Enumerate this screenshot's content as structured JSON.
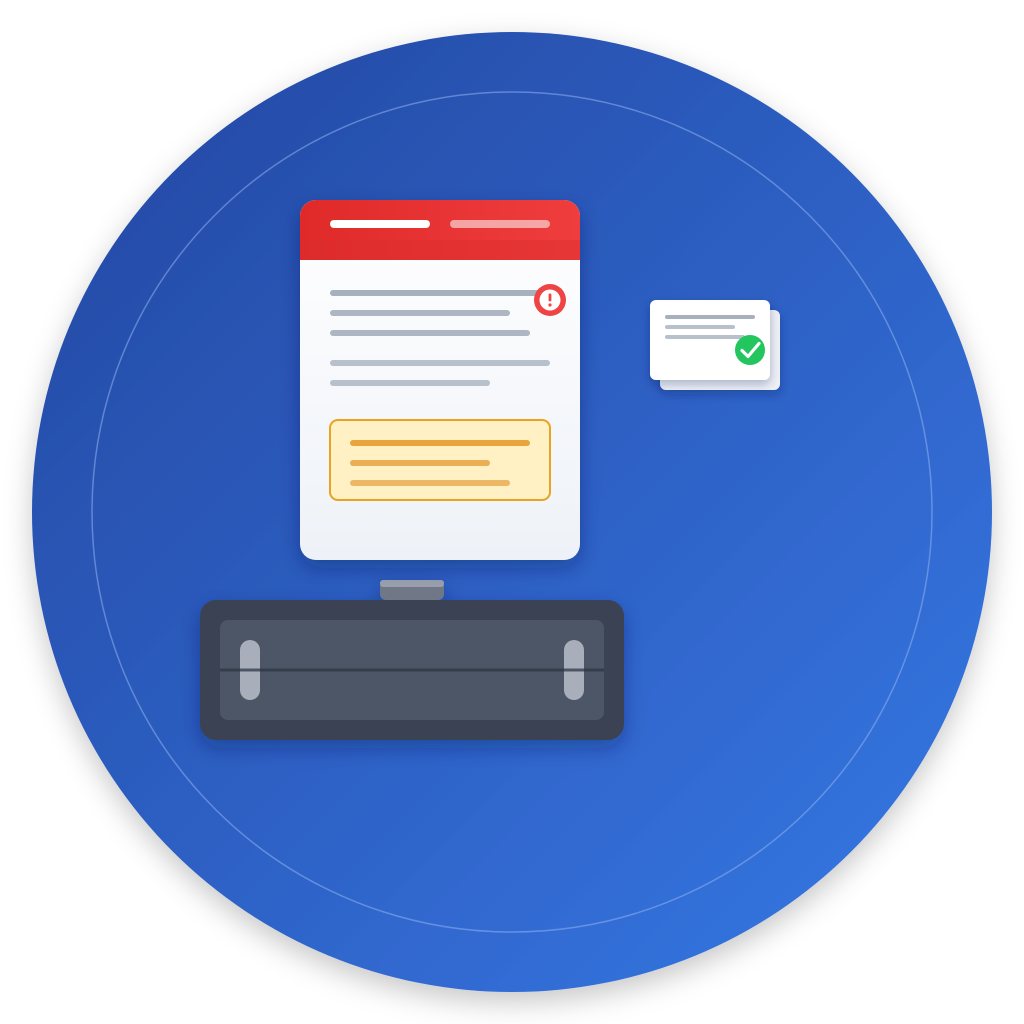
{
  "colors": {
    "background": "#ffffff",
    "circle_gradient_start": "#2446a0",
    "circle_gradient_end": "#3679e6",
    "inner_ring": "#8fb0f0",
    "document_header": "#e53535",
    "document_body": "#f5f7fb",
    "text_lines": "#a7b0bf",
    "warning_badge": "#ef4444",
    "highlight_box_fill": "#fff1c4",
    "highlight_box_border": "#e8a320",
    "highlight_lines": "#e9a43c",
    "card_fill": "#ffffff",
    "check_badge": "#22c55e",
    "printer_body": "#3b4253",
    "printer_panel": "#4d5666",
    "printer_clip": "#7e8696"
  },
  "icons": {
    "warning": "exclamation-icon",
    "success": "checkmark-icon"
  }
}
